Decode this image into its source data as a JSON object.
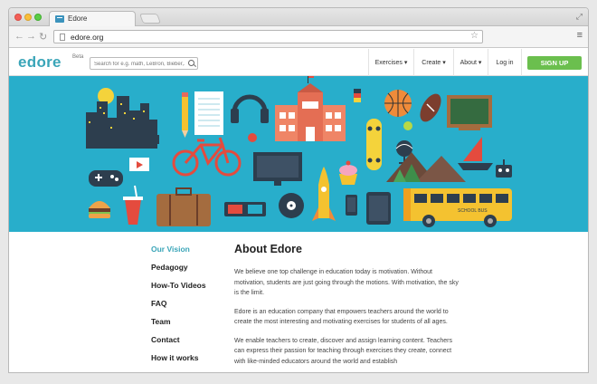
{
  "browser": {
    "tab_title": "Edore",
    "url": "edore.org"
  },
  "site": {
    "logo": "edore",
    "logo_badge": "Beta",
    "search_placeholder": "Search for e.g. math, LeBron, Bieber,...",
    "nav": {
      "exercises": "Exercises ▾",
      "create": "Create ▾",
      "about": "About ▾",
      "login": "Log in",
      "signup": "SIGN UP"
    },
    "hero_bus_label": "SCHOOL BUS"
  },
  "sidebar": {
    "items": [
      {
        "label": "Our Vision"
      },
      {
        "label": "Pedagogy"
      },
      {
        "label": "How-To Videos"
      },
      {
        "label": "FAQ"
      },
      {
        "label": "Team"
      },
      {
        "label": "Contact"
      },
      {
        "label": "How it works"
      }
    ]
  },
  "article": {
    "title": "About Edore",
    "paragraphs": [
      "We believe one top challenge in education today is motivation. Without motivation, students are just going through the motions. With motivation, the sky is the limit.",
      "Edore is an education company that empowers teachers around the world to create the most interesting and motivating exercises for students of all ages.",
      "We enable teachers to create, discover and assign learning content. Teachers can express their passion for teaching through exercises they create, connect with like-minded educators around the world and establish"
    ]
  },
  "colors": {
    "brand": "#3aa5b8",
    "hero_bg": "#28aecb",
    "signup": "#6bbf4e"
  }
}
